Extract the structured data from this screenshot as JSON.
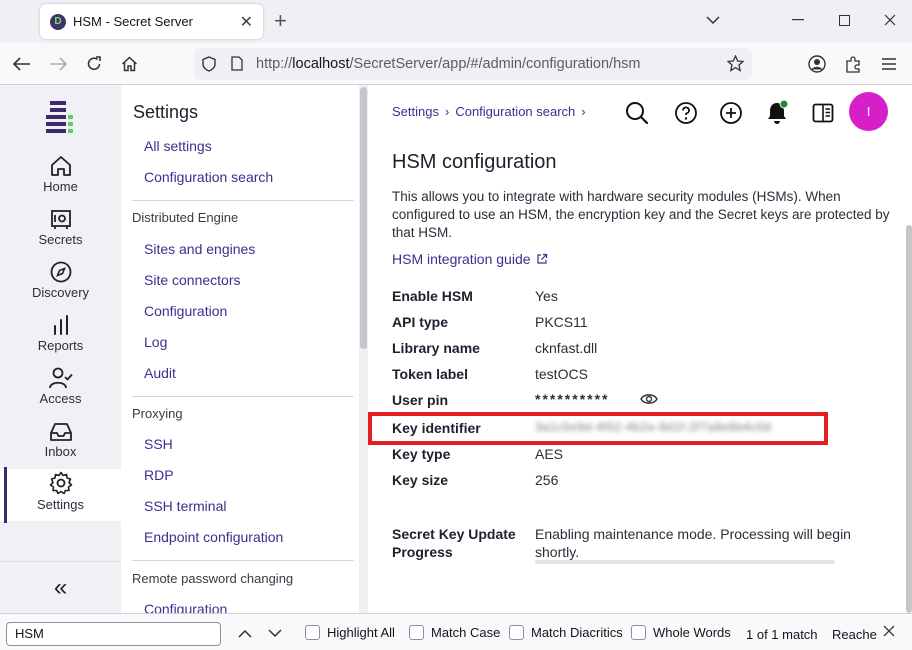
{
  "browser": {
    "tab_title": "HSM - Secret Server",
    "favicon_letter": "D",
    "url_prefix": "http://",
    "url_host": "localhost",
    "url_path": "/SecretServer/app/#/admin/configuration/hsm"
  },
  "rail": {
    "items": [
      {
        "label": "Home",
        "icon": "home-icon"
      },
      {
        "label": "Secrets",
        "icon": "vault-icon"
      },
      {
        "label": "Discovery",
        "icon": "compass-icon"
      },
      {
        "label": "Reports",
        "icon": "bar-chart-icon"
      },
      {
        "label": "Access",
        "icon": "user-check-icon"
      },
      {
        "label": "Inbox",
        "icon": "inbox-icon"
      },
      {
        "label": "Settings",
        "icon": "gear-icon"
      }
    ],
    "collapse_glyph": "«"
  },
  "settings_nav": {
    "title": "Settings",
    "top_links": [
      "All settings",
      "Configuration search"
    ],
    "groups": [
      {
        "heading": "Distributed Engine",
        "links": [
          "Sites and engines",
          "Site connectors",
          "Configuration",
          "Log",
          "Audit"
        ]
      },
      {
        "heading": "Proxying",
        "links": [
          "SSH",
          "RDP",
          "SSH terminal",
          "Endpoint configuration"
        ]
      },
      {
        "heading": "Remote password changing",
        "links": [
          "Configuration"
        ]
      }
    ]
  },
  "header": {
    "breadcrumb": [
      "Settings",
      "Configuration search"
    ],
    "avatar_initial": "I"
  },
  "hsm": {
    "section_title": "HSM configuration",
    "description": "This allows you to integrate with hardware security modules (HSMs). When configured to use an HSM, the encryption key and the Secret keys are protected by that HSM.",
    "guide_link": "HSM integration guide",
    "fields": [
      {
        "label": "Enable HSM",
        "value": "Yes"
      },
      {
        "label": "API type",
        "value": "PKCS11"
      },
      {
        "label": "Library name",
        "value": "cknfast.dll"
      },
      {
        "label": "Token label",
        "value": "testOCS"
      },
      {
        "label": "User pin",
        "value": "**********"
      },
      {
        "label": "Key identifier",
        "value": "3a1c5e9d-4f02-4b2e-9d1f-2f7a8e6b4c0d"
      },
      {
        "label": "Key type",
        "value": "AES"
      },
      {
        "label": "Key size",
        "value": "256"
      }
    ],
    "update_progress_label_1": "Secret Key Update",
    "update_progress_label_2": "Progress",
    "update_progress_text_1": "Enabling maintenance mode. Processing will begin",
    "update_progress_text_2": "shortly."
  },
  "findbar": {
    "query": "HSM",
    "options": [
      "Highlight All",
      "Match Case",
      "Match Diacritics",
      "Whole Words"
    ],
    "status": "1 of 1 match",
    "status_truncated": "Reache"
  },
  "colors": {
    "accent": "#3b2f8f",
    "avatar": "#d61fc8",
    "highlight_box": "#e02020",
    "notification_dot": "#1e8c3a"
  }
}
